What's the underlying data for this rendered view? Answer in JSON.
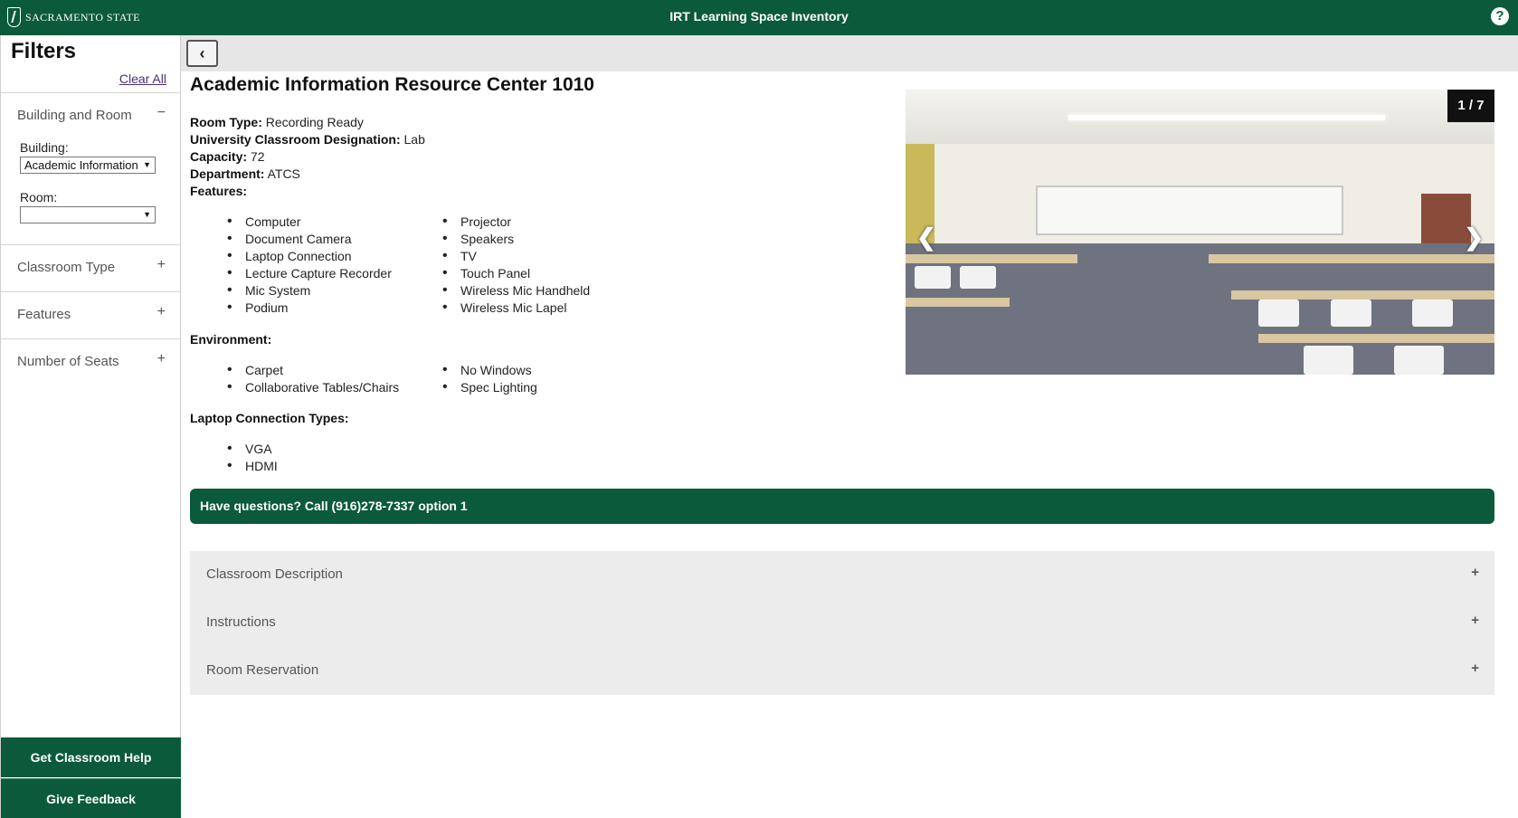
{
  "header": {
    "logo_text": "SACRAMENTO STATE",
    "title": "IRT Learning Space Inventory",
    "help_label": "?"
  },
  "sidebar": {
    "title": "Filters",
    "clear_all": "Clear All",
    "sections": [
      {
        "label": "Building and Room",
        "toggle": "−"
      },
      {
        "label": "Classroom Type",
        "toggle": "+"
      },
      {
        "label": "Features",
        "toggle": "+"
      },
      {
        "label": "Number of Seats",
        "toggle": "+"
      }
    ],
    "building_label": "Building:",
    "building_value": "Academic Information",
    "room_label": "Room:",
    "room_value": "",
    "help_button": "Get Classroom Help",
    "feedback_button": "Give Feedback"
  },
  "room": {
    "title": "Academic Information Resource Center 1010",
    "room_type_label": "Room Type:",
    "room_type": "Recording Ready",
    "designation_label": "University Classroom Designation:",
    "designation": "Lab",
    "capacity_label": "Capacity:",
    "capacity": "72",
    "department_label": "Department:",
    "department": "ATCS",
    "features_label": "Features:",
    "features": [
      "Computer",
      "Document Camera",
      "Laptop Connection",
      "Lecture Capture Recorder",
      "Mic System",
      "Podium",
      "Projector",
      "Speakers",
      "TV",
      "Touch Panel",
      "Wireless Mic Handheld",
      "Wireless Mic Lapel"
    ],
    "environment_label": "Environment:",
    "environment": [
      "Carpet",
      "Collaborative Tables/Chairs",
      "No Windows",
      "Spec Lighting"
    ],
    "laptop_label": "Laptop Connection Types:",
    "laptop_types": [
      "VGA",
      "HDMI"
    ]
  },
  "carousel": {
    "counter": "1 / 7",
    "prev": "❮",
    "next": "❯"
  },
  "help_bar": "Have questions? Call (916)278-7337 option 1",
  "accordion": [
    {
      "label": "Classroom Description",
      "toggle": "+"
    },
    {
      "label": "Instructions",
      "toggle": "+"
    },
    {
      "label": "Room Reservation",
      "toggle": "+"
    }
  ],
  "colors": {
    "brand_green": "#0b5a3c",
    "link_purple": "#4b2e83"
  }
}
